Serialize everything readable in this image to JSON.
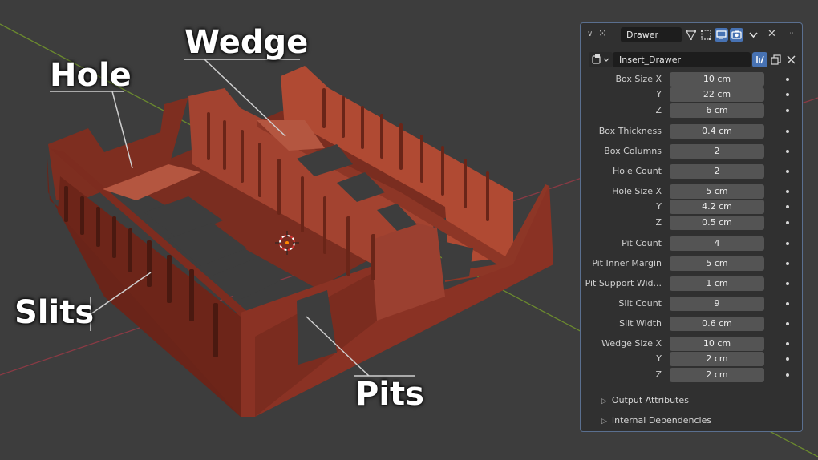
{
  "callouts": {
    "hole": "Hole",
    "wedge": "Wedge",
    "slits": "Slits",
    "pits": "Pits"
  },
  "panel": {
    "modifier_name": "Drawer",
    "node_group": "Insert_Drawer",
    "properties": [
      {
        "label": "Box Size X",
        "value": "10 cm"
      },
      {
        "label": "Y",
        "value": "22 cm"
      },
      {
        "label": "Z",
        "value": "6 cm"
      },
      {
        "label": "Box Thickness",
        "value": "0.4 cm"
      },
      {
        "label": "Box Columns",
        "value": "2"
      },
      {
        "label": "Hole Count",
        "value": "2"
      },
      {
        "label": "Hole Size X",
        "value": "5 cm"
      },
      {
        "label": "Y",
        "value": "4.2 cm"
      },
      {
        "label": "Z",
        "value": "0.5 cm"
      },
      {
        "label": "Pit Count",
        "value": "4"
      },
      {
        "label": "Pit Inner Margin",
        "value": "5 cm"
      },
      {
        "label": "Pit Support Wid...",
        "value": "1 cm"
      },
      {
        "label": "Slit Count",
        "value": "9"
      },
      {
        "label": "Slit Width",
        "value": "0.6 cm"
      },
      {
        "label": "Wedge Size X",
        "value": "10 cm"
      },
      {
        "label": "Y",
        "value": "2 cm"
      },
      {
        "label": "Z",
        "value": "2 cm"
      }
    ],
    "subpanels": [
      "Output Attributes",
      "Internal Dependencies"
    ]
  }
}
